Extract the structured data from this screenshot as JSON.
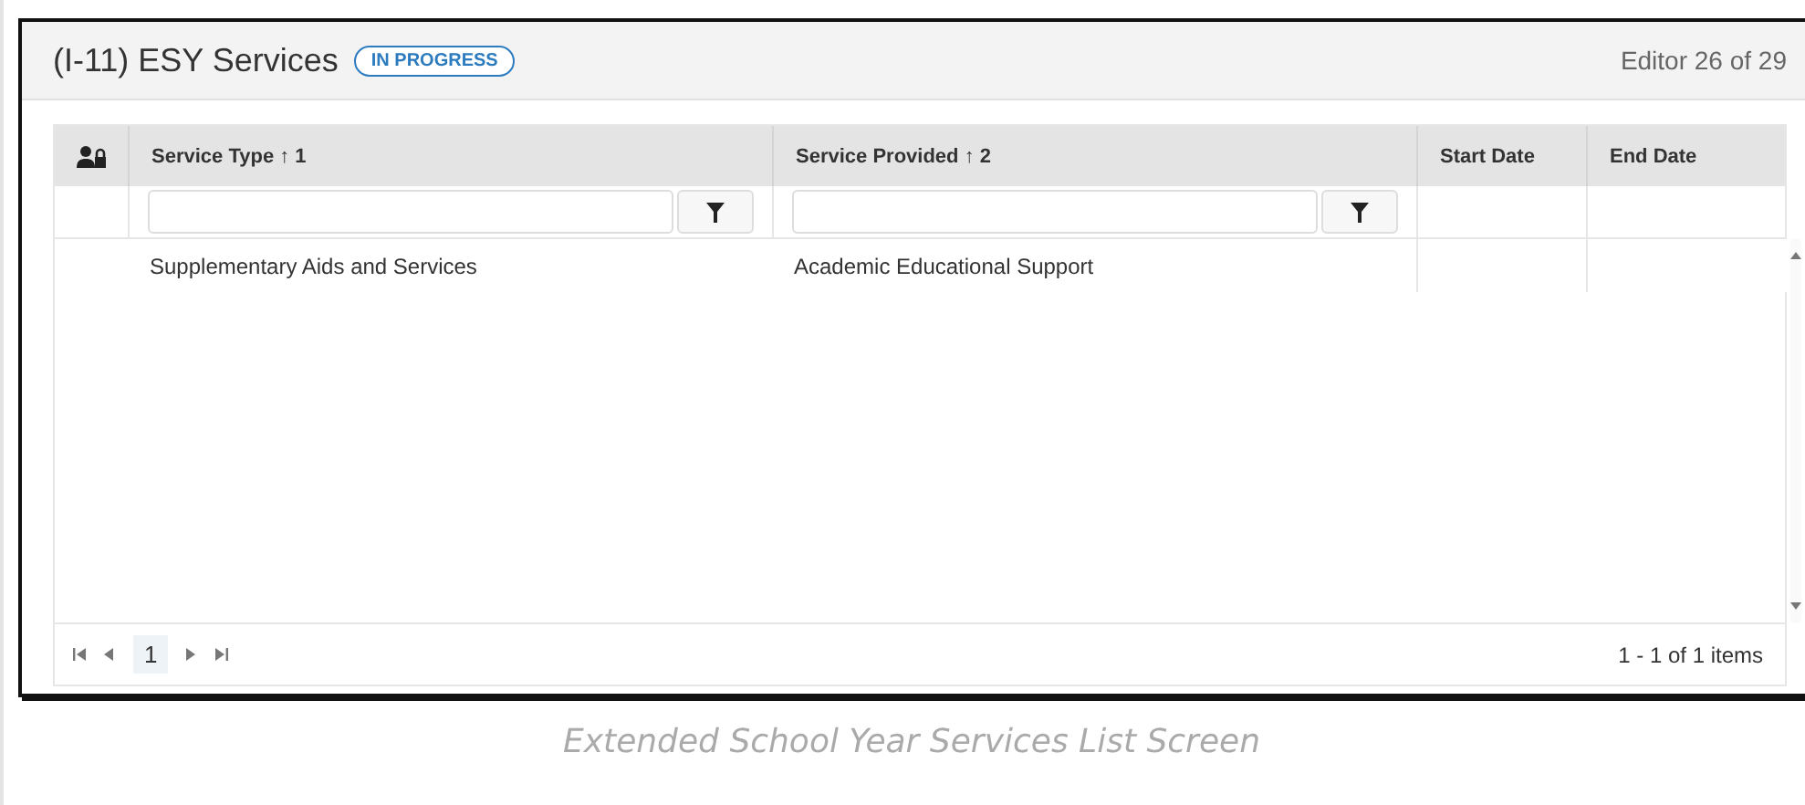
{
  "header": {
    "title": "(I-11) ESY Services",
    "status": "IN PROGRESS",
    "counter": "Editor 26 of 29"
  },
  "table": {
    "columns": [
      {
        "label": "Service Type ↑ 1",
        "filter": true
      },
      {
        "label": "Service Provided ↑ 2",
        "filter": true
      },
      {
        "label": "Start Date",
        "filter": false
      },
      {
        "label": "End Date",
        "filter": false
      }
    ],
    "rows": [
      [
        "Supplementary Aids and Services",
        "Academic Educational Support",
        "",
        ""
      ]
    ]
  },
  "pager": {
    "page": "1",
    "summary": "1 - 1 of 1 items"
  },
  "caption": "Extended School Year Services List Screen"
}
